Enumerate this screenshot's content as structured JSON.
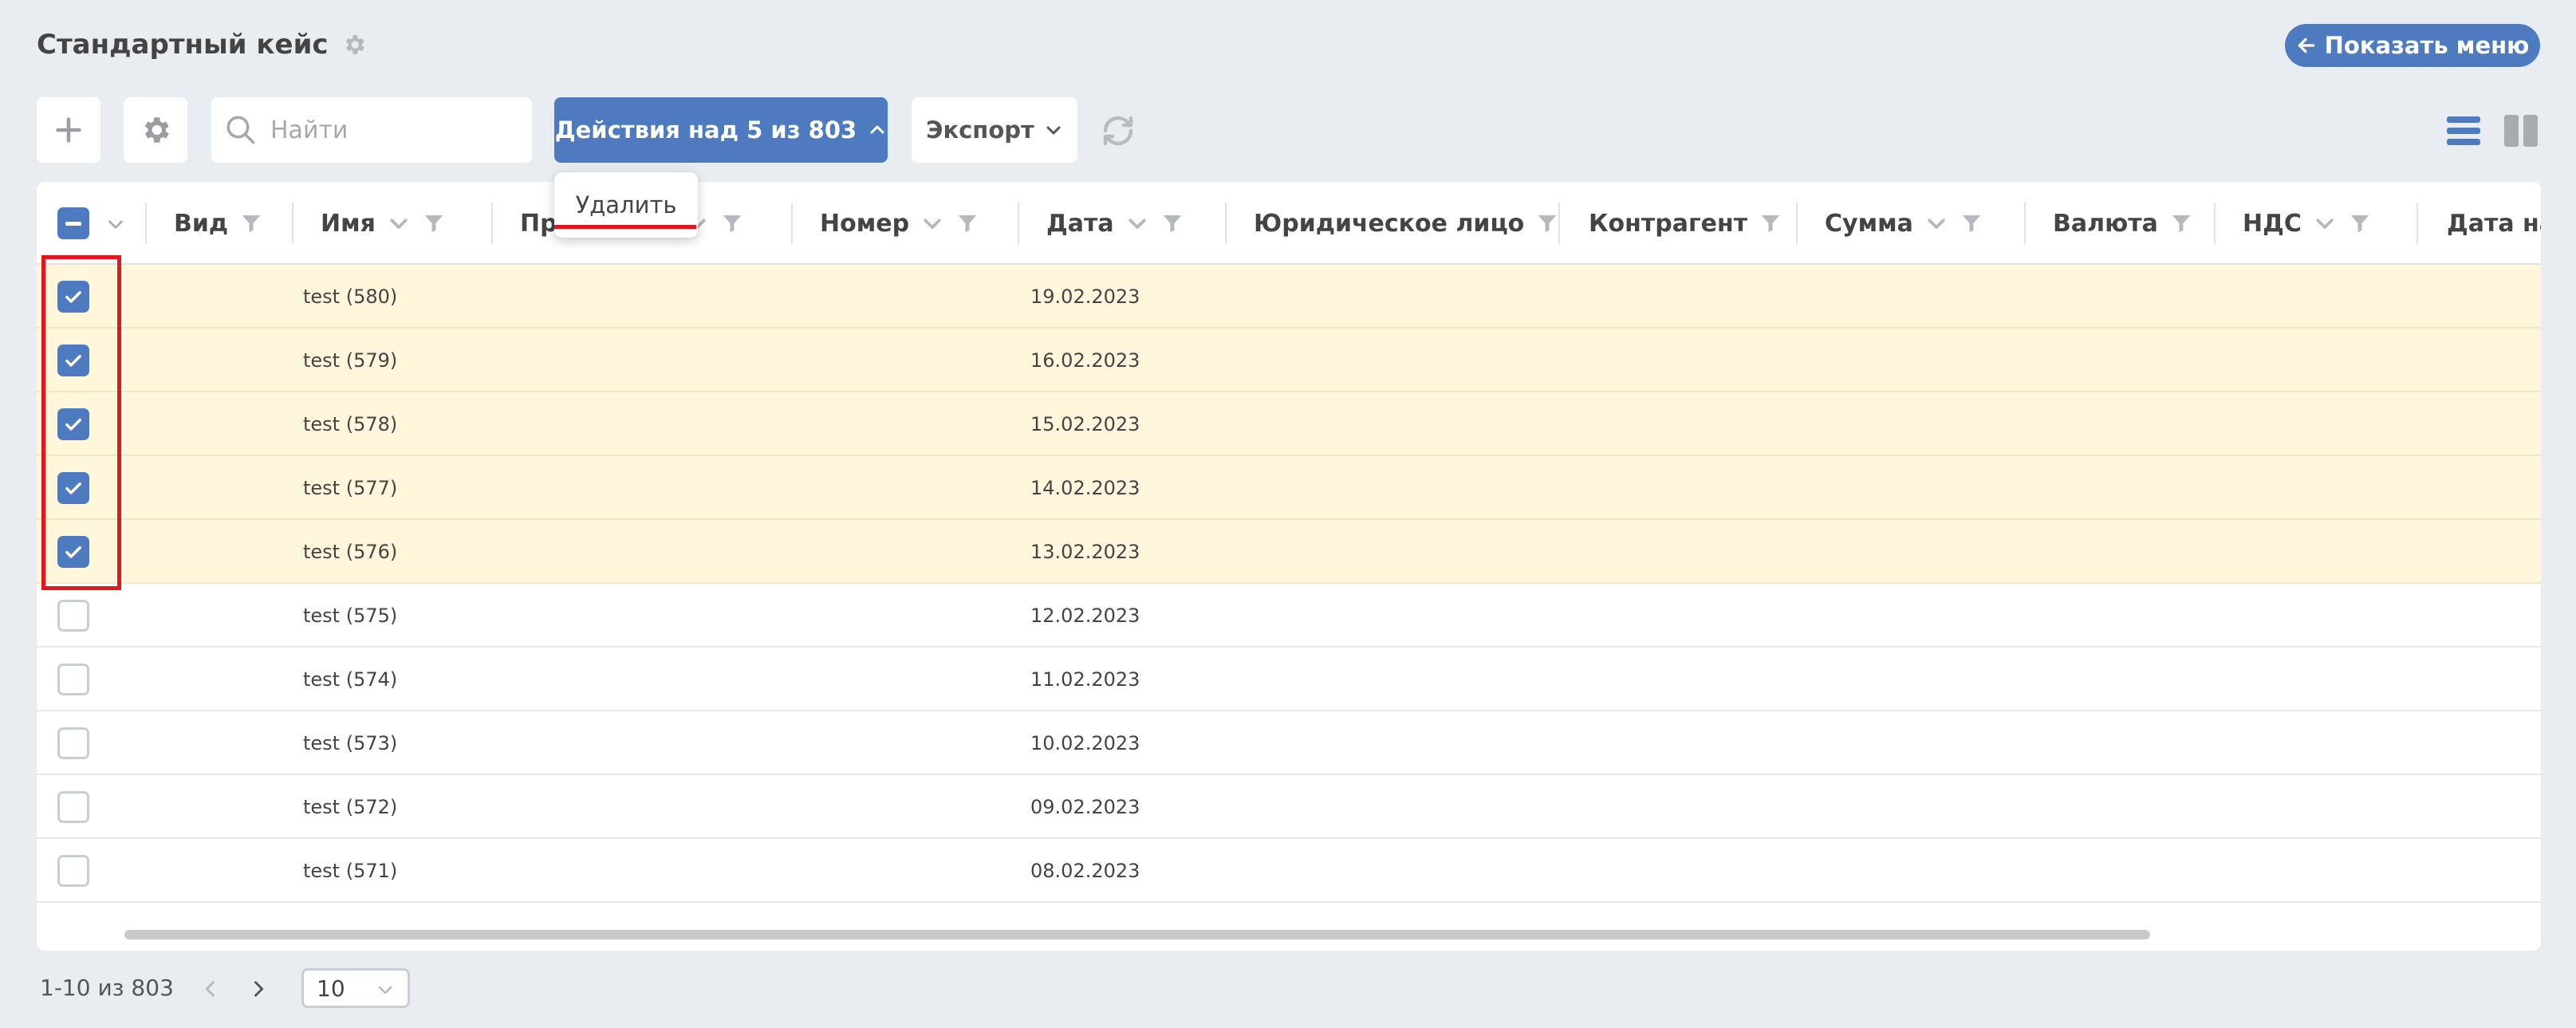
{
  "header": {
    "title": "Стандартный кейс",
    "show_menu_label": "Показать меню"
  },
  "toolbar": {
    "search_placeholder": "Найти",
    "actions_label": "Действия над 5 из 803",
    "export_label": "Экспорт"
  },
  "actions_menu": {
    "items": [
      "Удалить"
    ]
  },
  "table": {
    "columns": [
      "Вид",
      "Имя",
      "Пр",
      "Номер",
      "Дата",
      "Юридическое лицо",
      "Контрагент",
      "Сумма",
      "Валюта",
      "НДС",
      "Дата нач"
    ],
    "rows": [
      {
        "name": "test (580)",
        "date": "19.02.2023",
        "selected": true
      },
      {
        "name": "test (579)",
        "date": "16.02.2023",
        "selected": true
      },
      {
        "name": "test (578)",
        "date": "15.02.2023",
        "selected": true
      },
      {
        "name": "test (577)",
        "date": "14.02.2023",
        "selected": true
      },
      {
        "name": "test (576)",
        "date": "13.02.2023",
        "selected": true
      },
      {
        "name": "test (575)",
        "date": "12.02.2023",
        "selected": false
      },
      {
        "name": "test (574)",
        "date": "11.02.2023",
        "selected": false
      },
      {
        "name": "test (573)",
        "date": "10.02.2023",
        "selected": false
      },
      {
        "name": "test (572)",
        "date": "09.02.2023",
        "selected": false
      },
      {
        "name": "test (571)",
        "date": "08.02.2023",
        "selected": false
      }
    ]
  },
  "pagination": {
    "range_text": "1-10 из 803",
    "page_size": "10"
  },
  "colors": {
    "accent": "#4e7abf",
    "selected_row": "#fff6dc",
    "highlight": "#e0171b",
    "background": "#e8edf1"
  },
  "icons": {
    "title": "gear-icon",
    "show_menu": "arrow-left-icon",
    "add": "plus-icon",
    "settings": "gear-icon",
    "search": "search-icon",
    "actions": "chevron-up-icon",
    "export": "chevron-down-icon",
    "refresh": "refresh-icon",
    "list_view": "list-view-icon",
    "columns_view": "columns-view-icon",
    "sort": "chevron-down-icon",
    "filter": "filter-icon",
    "prev": "chevron-left-icon",
    "next": "chevron-right-icon"
  }
}
